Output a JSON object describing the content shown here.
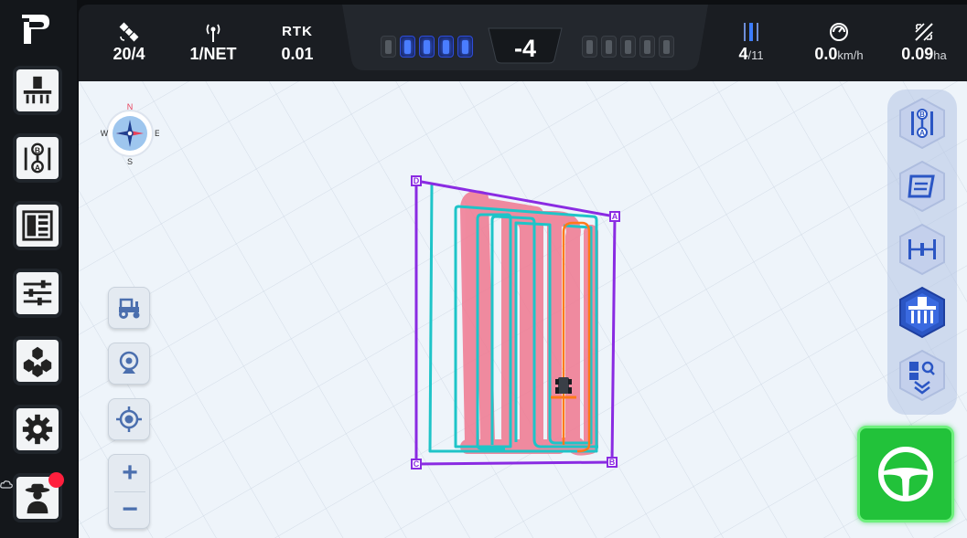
{
  "app": {
    "logo": "FP"
  },
  "sidebar": {
    "items": [
      {
        "name": "implement",
        "icon": "implement-icon"
      },
      {
        "name": "ab-line",
        "icon": "ab-line-icon"
      },
      {
        "name": "field-data",
        "icon": "field-data-icon"
      },
      {
        "name": "settings-sliders",
        "icon": "sliders-icon"
      },
      {
        "name": "modules",
        "icon": "modules-icon"
      },
      {
        "name": "system-settings",
        "icon": "gear-icon"
      },
      {
        "name": "user",
        "icon": "farmer-avatar-icon",
        "badge_color": "#ff1f3d"
      }
    ]
  },
  "status": {
    "satellites": "20/4",
    "network": "1/NET",
    "rtk_label": "RTK",
    "rtk_value": "0.01",
    "line_offset": "-4",
    "left_leds_on": 4,
    "right_leds_on": 0,
    "pass_number": "4",
    "pass_total": "/11",
    "speed_value": "0.0",
    "speed_unit": "km/h",
    "area_value": "0.09",
    "area_unit": "ha"
  },
  "compass": {
    "n": "N",
    "s": "S",
    "e": "E",
    "w": "W"
  },
  "map": {
    "boundary_points": [
      "D",
      "A",
      "B",
      "C"
    ],
    "colors": {
      "boundary": "#8a2be2",
      "coverage": "#f07890",
      "path": "#1ec4c8",
      "guidance": "#ff7a1a",
      "accent": "#2b56c4",
      "steer": "#22c23a"
    }
  },
  "map_tools": {
    "zoom_in": "+",
    "zoom_out": "−"
  },
  "right_panel": {
    "items": [
      {
        "name": "ab-mode",
        "icon": "ab-mode-icon"
      },
      {
        "name": "line-shift",
        "icon": "line-shift-icon"
      },
      {
        "name": "implement-width",
        "icon": "width-icon"
      },
      {
        "name": "implement-view",
        "icon": "implement-view-icon",
        "active": true
      },
      {
        "name": "field-search",
        "icon": "field-search-icon"
      }
    ]
  }
}
